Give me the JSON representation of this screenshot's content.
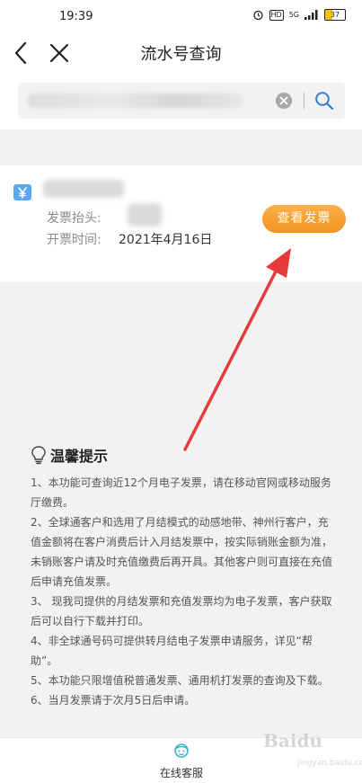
{
  "status_bar": {
    "time": "19:39",
    "network_badge": "HD",
    "signal_label": "5G",
    "battery_level": "37",
    "battery_fraction": 0.37
  },
  "nav": {
    "title": "流水号查询"
  },
  "search": {
    "value_obscured": true
  },
  "invoice": {
    "header_label": "发票抬头:",
    "date_label": "开票时间:",
    "date_value": "2021年4月16日",
    "view_button": "查看发票"
  },
  "tips": {
    "title": "温馨提示",
    "items": [
      "1、本功能可查询近12个月电子发票，请在移动官网或移动服务厅缴费。",
      "2、全球通客户和选用了月结模式的动感地带、神州行客户，充值金额将在客户消费后计入月结发票中，按实际销账金额为准，未销账客户请及时充值缴费后再开具。其他客户则可直接在充值后申请充值发票。",
      "3、 现我司提供的月结发票和充值发票均为电子发票，客户获取后可以自行下载并打印。",
      "4、非全球通号码可提供转月结电子发票申请服务，详见“帮助”。",
      "5、本功能只限增值税普通发票、通用机打发票的查询及下载。",
      "6、当月发票请于次月5日后申请。"
    ]
  },
  "bottom": {
    "service_label": "在线客服"
  },
  "watermark": {
    "brand": "Baidu",
    "sub": "jingyan.baidu.com"
  },
  "colors": {
    "accent_orange": "#f5a030",
    "search_blue": "#2f7ad8",
    "arrow_red": "#e53b3b",
    "icon_blue": "#5aa9f0"
  }
}
